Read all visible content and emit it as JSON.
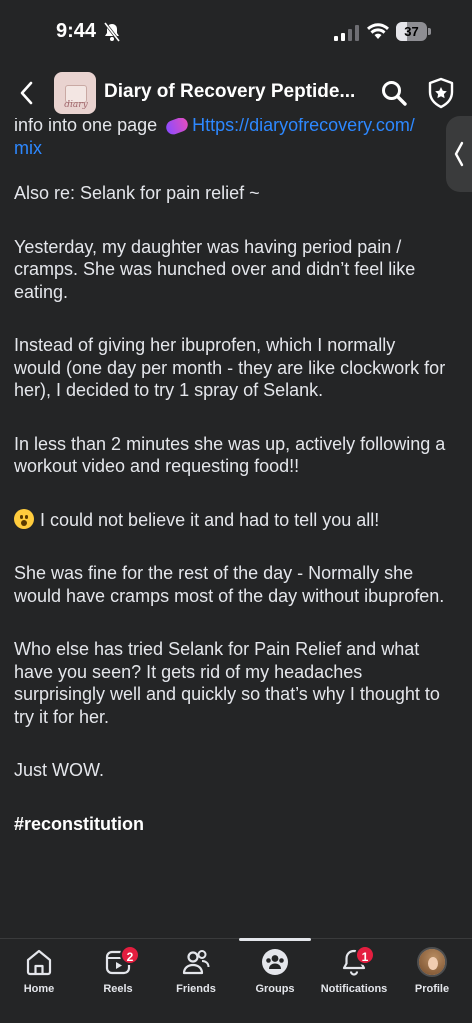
{
  "status_bar": {
    "time": "9:44",
    "battery": "37",
    "battery_level": 0.37
  },
  "header": {
    "title": "Diary of Recovery Peptide...",
    "avatar_text": "diary"
  },
  "post": {
    "link_prefix": "info into one page ",
    "link_url_part1": "Https://diaryofrecovery.com/",
    "link_url_part2": "mix",
    "paragraphs": [
      "Also re: Selank for pain relief ~",
      "Yesterday, my daughter was having period pain / cramps. She was hunched over and didn’t feel like eating.",
      "Instead of giving her ibuprofen, which I normally would (one day per month - they are like clockwork for her), I decided to try 1 spray of Selank.",
      "In less than 2 minutes she was up, actively following a workout video and requesting food!!",
      "I could not believe it and had to tell you all!",
      "She was fine for the rest of the day - Normally she would have cramps most of the day without ibuprofen.",
      "Who else has tried Selank for Pain Relief and what have you seen?  It gets rid of my headaches surprisingly well and quickly so that’s why I thought to try it for her.",
      "Just WOW.",
      "#reconstitution"
    ]
  },
  "nav": {
    "home": "Home",
    "reels": "Reels",
    "reels_badge": "2",
    "friends": "Friends",
    "groups": "Groups",
    "notifications": "Notifications",
    "notifications_badge": "1",
    "profile": "Profile"
  }
}
